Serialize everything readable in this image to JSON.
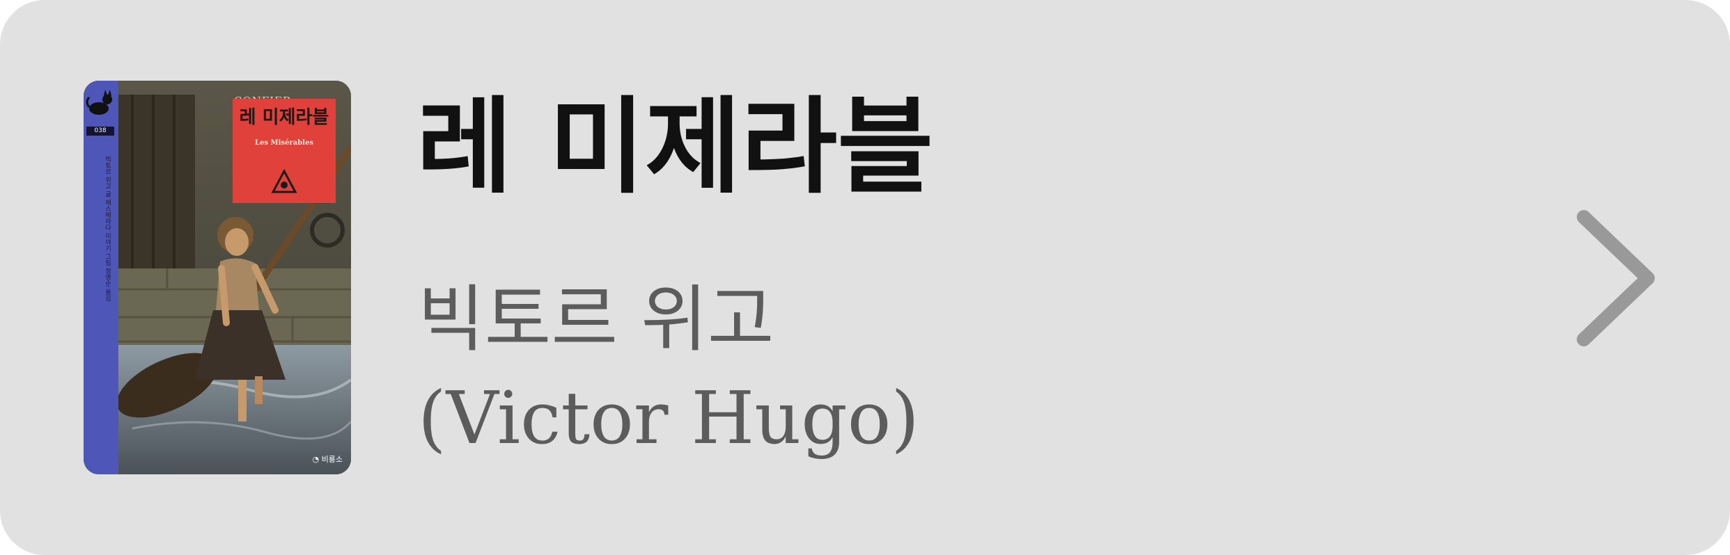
{
  "card": {
    "title": "레 미제라블",
    "author_name_korean": "빅토르 위고",
    "author_name_original": "(Victor Hugo)"
  },
  "cover": {
    "top_label": "CONFIER",
    "title_korean": "레 미제라블",
    "title_original": "Les Misérables",
    "series_number": "038",
    "spine_text": "빅토르 위고 글   에스메라다 이야기 그림   정명순 옮김",
    "publisher": "비룡소"
  },
  "icons": {
    "chevron": "chevron-right-icon",
    "cat_logo": "black-cat-logo-icon",
    "publisher_logo": "publisher-logo-icon"
  },
  "colors": {
    "card_background": "#e1e1e1",
    "title_text": "#111111",
    "author_text": "#5c5c5c",
    "chevron": "#999999",
    "cover_spine": "#4e57b8",
    "cover_title_block": "#e0423b"
  }
}
